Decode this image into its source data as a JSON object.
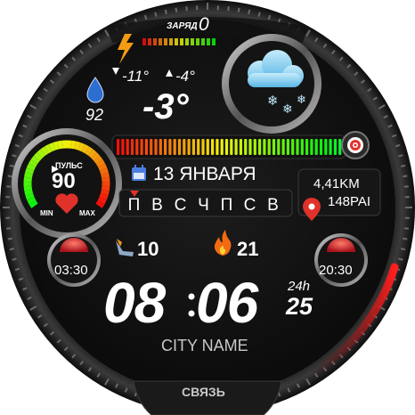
{
  "battery": {
    "label": "ЗАРЯД",
    "value": "0",
    "level_fraction": 0.0
  },
  "weather": {
    "low": "-11°",
    "high": "-4°",
    "current": "-3°",
    "humidity": "92",
    "condition_icon": "cloud-snow-icon"
  },
  "heart": {
    "label": "ПУЛЬС",
    "value": "90",
    "min_label": "MIN",
    "max_label": "MAX",
    "level_fraction": 0.45
  },
  "activity": {
    "bar_fraction": 1.0,
    "goal_icon": "target-icon"
  },
  "date": {
    "text": "13 ЯНВАРЯ",
    "weekdays": [
      "П",
      "В",
      "С",
      "Ч",
      "П",
      "С",
      "В"
    ],
    "current_weekday_index": 0
  },
  "distance": {
    "km": "4,41KM",
    "pai": "148PAI"
  },
  "steps_left": "10",
  "calories": "21",
  "sunrise": "03:30",
  "sunset": "20:30",
  "time": {
    "hhmm": "08:06",
    "hours": "08",
    "minutes": "06",
    "format": "24h",
    "seconds": "25"
  },
  "city": "CITY NAME",
  "bottom_button": "СВЯЗЬ",
  "colors": {
    "accent_orange": "#f39c12",
    "accent_red": "#e0312b",
    "weather_cloud": "#8fd6f2",
    "calendar_blue": "#4a7ee0"
  }
}
